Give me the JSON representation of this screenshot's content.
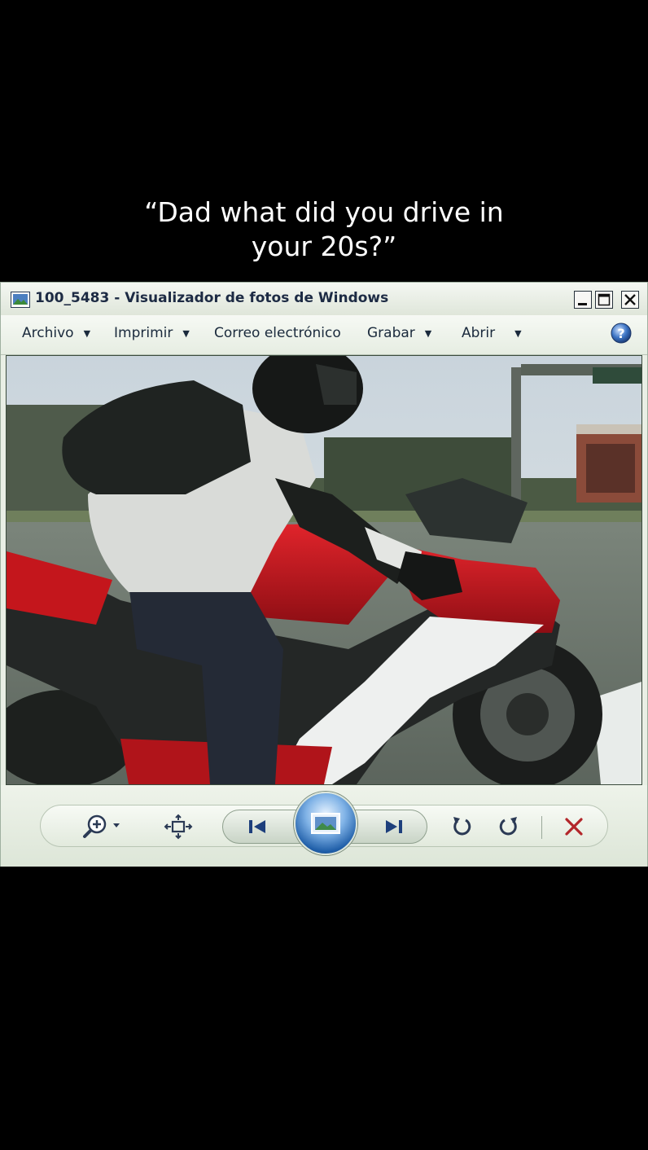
{
  "caption": {
    "line1": "“Dad what did you drive in",
    "line2": "your 20s?”"
  },
  "window": {
    "title": "100_5483 - Visualizador de fotos de Windows",
    "controls": [
      "minimize",
      "maximize",
      "close"
    ]
  },
  "menu": {
    "items": [
      {
        "label": "Archivo",
        "has_dropdown": true
      },
      {
        "label": "Imprimir",
        "has_dropdown": true
      },
      {
        "label": "Correo electrónico",
        "has_dropdown": false
      },
      {
        "label": "Grabar",
        "has_dropdown": true
      },
      {
        "label": "Abrir",
        "has_dropdown": true
      }
    ],
    "help_icon": "help-icon"
  },
  "photo": {
    "subject": "rider-on-motorcycle-photo"
  },
  "toolbar": {
    "buttons": [
      "zoom-icon",
      "actual-size-icon",
      "previous-icon",
      "slideshow-icon",
      "next-icon",
      "rotate-counterclockwise-icon",
      "rotate-clockwise-icon",
      "delete-icon"
    ]
  },
  "colors": {
    "accent_blue": "#1f5ea8",
    "delete_red": "#b3262a",
    "bike_red": "#c4161c"
  }
}
